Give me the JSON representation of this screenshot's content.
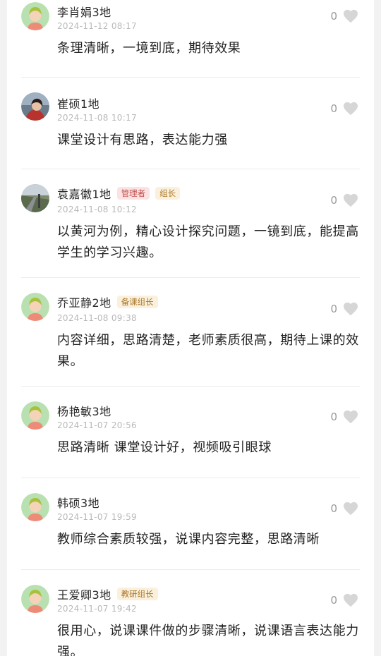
{
  "comments": [
    {
      "name": "李肖娟3地",
      "time": "2024-11-12 08:17",
      "likes": "0",
      "text": "条理清晰，一境到底，期待效果",
      "badges": []
    },
    {
      "name": "崔硕1地",
      "time": "2024-11-08 10:17",
      "likes": "0",
      "text": "课堂设计有思路，表达能力强",
      "badges": []
    },
    {
      "name": "袁嘉徽1地",
      "time": "2024-11-08 10:12",
      "likes": "0",
      "text": "以黄河为例，精心设计探究问题，一镜到底，能提高学生的学习兴趣。",
      "badges": [
        "管理者",
        "组长"
      ]
    },
    {
      "name": "乔亚静2地",
      "time": "2024-11-08 09:38",
      "likes": "0",
      "text": "内容详细，思路清楚，老师素质很高，期待上课的效果。",
      "badges": [
        "备课组长"
      ]
    },
    {
      "name": "杨艳敏3地",
      "time": "2024-11-07 20:56",
      "likes": "0",
      "text": "思路清晰 课堂设计好，视频吸引眼球",
      "badges": []
    },
    {
      "name": "韩硕3地",
      "time": "2024-11-07 19:59",
      "likes": "0",
      "text": "教师综合素质较强，说课内容完整，思路清晰",
      "badges": []
    },
    {
      "name": "王爱卿3地",
      "time": "2024-11-07 19:42",
      "likes": "0",
      "text": "很用心，说课课件做的步骤清晰，说课语言表达能力强。",
      "badges": [
        "教研组长"
      ]
    }
  ],
  "colors": {
    "avatar_bg": "#b9e0b0",
    "avatar_hair": "#a7c23a",
    "avatar_face": "#f4d3b8",
    "avatar_body": "#ee8b78",
    "heart": "#d6d6d6"
  }
}
